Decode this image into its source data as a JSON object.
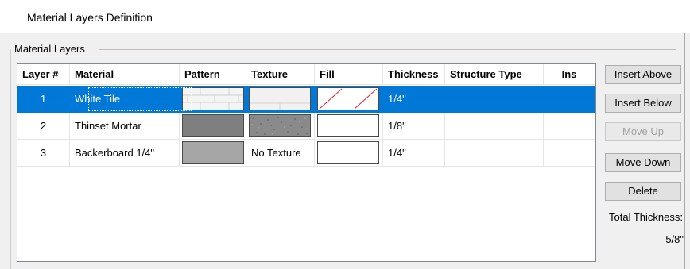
{
  "window": {
    "title": "Material Layers Definition"
  },
  "group": {
    "label": "Material Layers"
  },
  "table": {
    "columns": [
      "Layer #",
      "Material",
      "Pattern",
      "Texture",
      "Fill",
      "Thickness",
      "Structure Type",
      "Ins"
    ],
    "rows": [
      {
        "layer": "1",
        "material": "White Tile",
        "pattern": "brick-pattern",
        "texture": "tile-texture",
        "fill": "none-red-slash",
        "thickness": "1/4\"",
        "structure_type": "",
        "ins": "",
        "selected": true
      },
      {
        "layer": "2",
        "material": "Thinset Mortar",
        "pattern": "solid-gray",
        "texture": "speckled-gray",
        "fill": "white",
        "thickness": "1/8\"",
        "structure_type": "",
        "ins": "",
        "selected": false
      },
      {
        "layer": "3",
        "material": "Backerboard 1/4\"",
        "pattern": "solid-light-gray",
        "texture_text": "No Texture",
        "fill": "white",
        "thickness": "1/4\"",
        "structure_type": "",
        "ins": "",
        "selected": false
      }
    ]
  },
  "buttons": {
    "insert_above": "Insert Above",
    "insert_below": "Insert Below",
    "move_up": "Move Up",
    "move_down": "Move Down",
    "delete": "Delete"
  },
  "total": {
    "label": "Total Thickness:",
    "value": "5/8\""
  },
  "colors": {
    "selection": "#0078d7",
    "swatch_dark_gray": "#7f7f7f",
    "swatch_light_gray": "#a6a6a6",
    "fill_slash": "#e02020"
  }
}
